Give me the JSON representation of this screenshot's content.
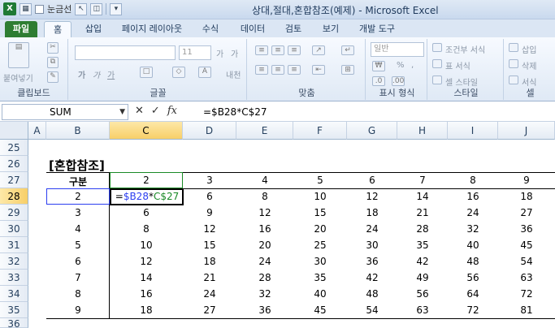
{
  "qat": {
    "logo": "X",
    "gridlines_label": "눈금선"
  },
  "window_title": "상대,절대,혼합참조(예제) - Microsoft Excel",
  "tabs": [
    "파일",
    "홈",
    "삽입",
    "페이지 레이아웃",
    "수식",
    "데이터",
    "검토",
    "보기",
    "개발 도구"
  ],
  "ribbon": {
    "groups": [
      "클립보드",
      "글꼴",
      "맞춤",
      "표시 형식",
      "스타일",
      "셀"
    ],
    "paste_label": "붙여넣기",
    "font_size": "11",
    "number_format": "일반",
    "cond_format": "조건부 서식",
    "table_format": "표 서식",
    "cell_style": "셀 스타일",
    "insert": "삽입",
    "delete": "삭제",
    "format": "서식",
    "bold": "가",
    "italic": "가",
    "underline": "가",
    "font_grow": "가",
    "font_shrink": "가",
    "phonetic": "내천",
    "percent": "%",
    "comma": ","
  },
  "formula_bar": {
    "name_box": "SUM",
    "cancel": "✕",
    "enter": "✓",
    "fx": "fx",
    "formula": "=$B28*C$27"
  },
  "columns": [
    "A",
    "B",
    "C",
    "D",
    "E",
    "F",
    "G",
    "H",
    "I",
    "J"
  ],
  "rows": [
    "25",
    "26",
    "27",
    "28",
    "29",
    "30",
    "31",
    "32",
    "33",
    "34",
    "35",
    "36"
  ],
  "sheet": {
    "title": "[혼합참조]",
    "corner_label": "구분",
    "header_values": [
      "2",
      "3",
      "4",
      "5",
      "6",
      "7",
      "8",
      "9"
    ],
    "row_labels": [
      "2",
      "3",
      "4",
      "5",
      "6",
      "7",
      "8",
      "9"
    ],
    "table": [
      [
        "",
        "6",
        "8",
        "10",
        "12",
        "14",
        "16",
        "18"
      ],
      [
        "6",
        "9",
        "12",
        "15",
        "18",
        "21",
        "24",
        "27"
      ],
      [
        "8",
        "12",
        "16",
        "20",
        "24",
        "28",
        "32",
        "36"
      ],
      [
        "10",
        "15",
        "20",
        "25",
        "30",
        "35",
        "40",
        "45"
      ],
      [
        "12",
        "18",
        "24",
        "30",
        "36",
        "42",
        "48",
        "54"
      ],
      [
        "14",
        "21",
        "28",
        "35",
        "42",
        "49",
        "56",
        "63"
      ],
      [
        "16",
        "24",
        "32",
        "40",
        "48",
        "56",
        "64",
        "72"
      ],
      [
        "18",
        "27",
        "36",
        "45",
        "54",
        "63",
        "72",
        "81"
      ]
    ],
    "edit_cell": {
      "eq": "=",
      "ref1": "$B28",
      "op": "*",
      "ref2": "C$27"
    }
  },
  "colors": {
    "file_tab": "#2e7d32",
    "selection": "#f8cf68",
    "ref_blue": "#2b3ef0",
    "ref_green": "#1a8a27"
  }
}
